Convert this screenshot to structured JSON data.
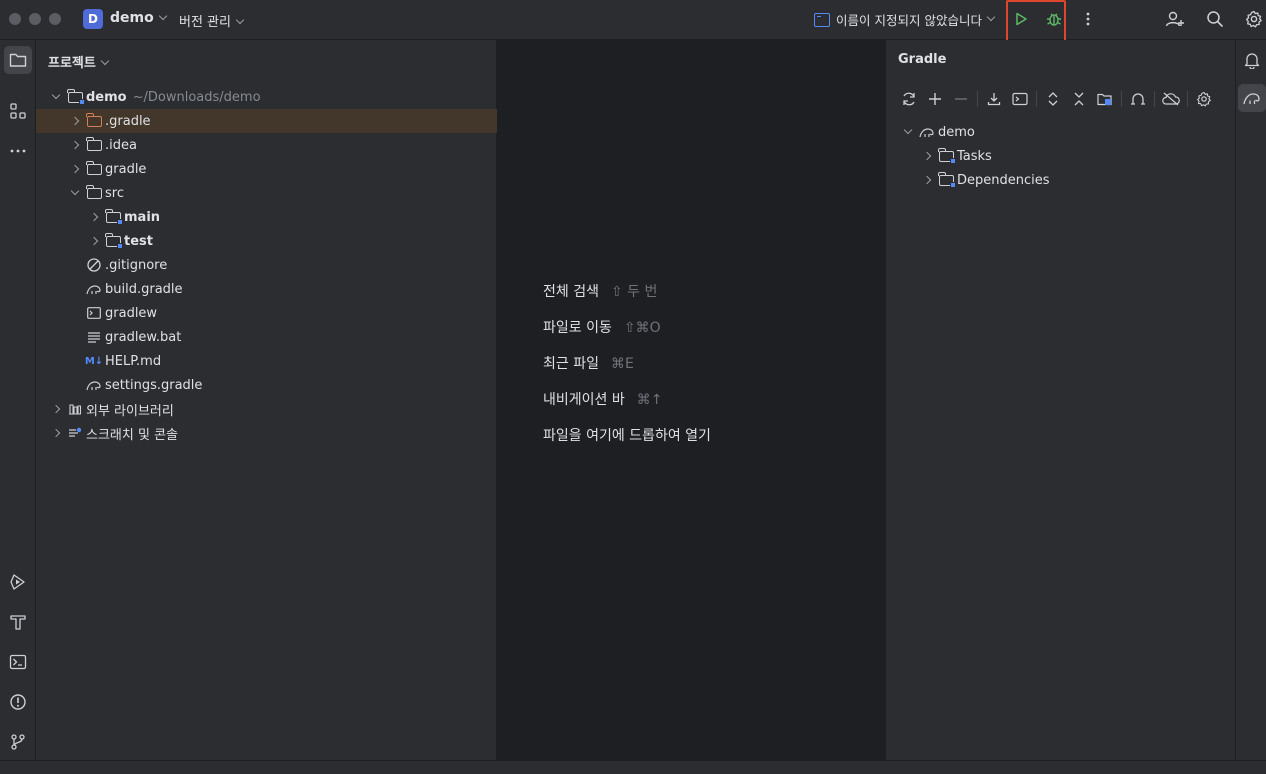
{
  "titlebar": {
    "project_badge": "D",
    "project_name": "demo",
    "vcs_menu": "버전 관리",
    "run_config": "이름이 지정되지 않았습니다",
    "run_icon": "play-icon",
    "debug_icon": "bug-icon",
    "more_icon": "more-vertical-icon",
    "add_user_icon": "add-user-icon",
    "search_icon": "search-icon",
    "settings_icon": "gear-icon",
    "highlight_color": "#e0452e"
  },
  "left_strip": {
    "icons": [
      "folder-icon",
      "structure-icon",
      "more-horizontal-icon",
      "run-services-icon",
      "build-hammer-icon",
      "terminal-icon",
      "problems-icon",
      "git-branch-icon"
    ]
  },
  "project_panel": {
    "title": "프로젝트",
    "root": {
      "name": "demo",
      "path": "~/Downloads/demo"
    },
    "items": [
      {
        "label": ".gradle",
        "type": "folder-excluded",
        "expanded": false,
        "depth": 1,
        "selected": true
      },
      {
        "label": ".idea",
        "type": "folder",
        "expanded": false,
        "depth": 1
      },
      {
        "label": "gradle",
        "type": "folder",
        "expanded": false,
        "depth": 1
      },
      {
        "label": "src",
        "type": "folder",
        "expanded": true,
        "depth": 1
      },
      {
        "label": "main",
        "type": "module-folder",
        "expanded": false,
        "depth": 2
      },
      {
        "label": "test",
        "type": "module-folder",
        "expanded": false,
        "depth": 2
      },
      {
        "label": ".gitignore",
        "type": "ignore-file",
        "depth": 1
      },
      {
        "label": "build.gradle",
        "type": "gradle-file",
        "depth": 1
      },
      {
        "label": "gradlew",
        "type": "shell-file",
        "depth": 1
      },
      {
        "label": "gradlew.bat",
        "type": "text-file",
        "depth": 1
      },
      {
        "label": "HELP.md",
        "type": "markdown-file",
        "depth": 1
      },
      {
        "label": "settings.gradle",
        "type": "gradle-file",
        "depth": 1
      }
    ],
    "external_libraries": "외부 라이브러리",
    "scratches": "스크래치 및 콘솔",
    "md_badge": "M↓"
  },
  "editor_hints": [
    {
      "label": "전체 검색",
      "shortcut": "⇧ 두 번"
    },
    {
      "label": "파일로 이동",
      "shortcut": "⇧⌘O"
    },
    {
      "label": "최근 파일",
      "shortcut": "⌘E"
    },
    {
      "label": "내비게이션 바",
      "shortcut": "⌘↑"
    },
    {
      "label": "파일을 여기에 드롭하여 열기",
      "shortcut": ""
    }
  ],
  "gradle_panel": {
    "title": "Gradle",
    "toolbar": [
      "refresh-icon",
      "add-icon",
      "remove-icon",
      "download-icon",
      "run-task-icon",
      "expand-all-icon",
      "collapse-all-icon",
      "dependencies-icon",
      "toggle-offline-icon",
      "cloud-off-icon",
      "settings-icon"
    ],
    "root": "demo",
    "children": [
      "Tasks",
      "Dependencies"
    ]
  },
  "right_strip": {
    "icons": [
      "notifications-icon",
      "gradle-icon"
    ]
  }
}
